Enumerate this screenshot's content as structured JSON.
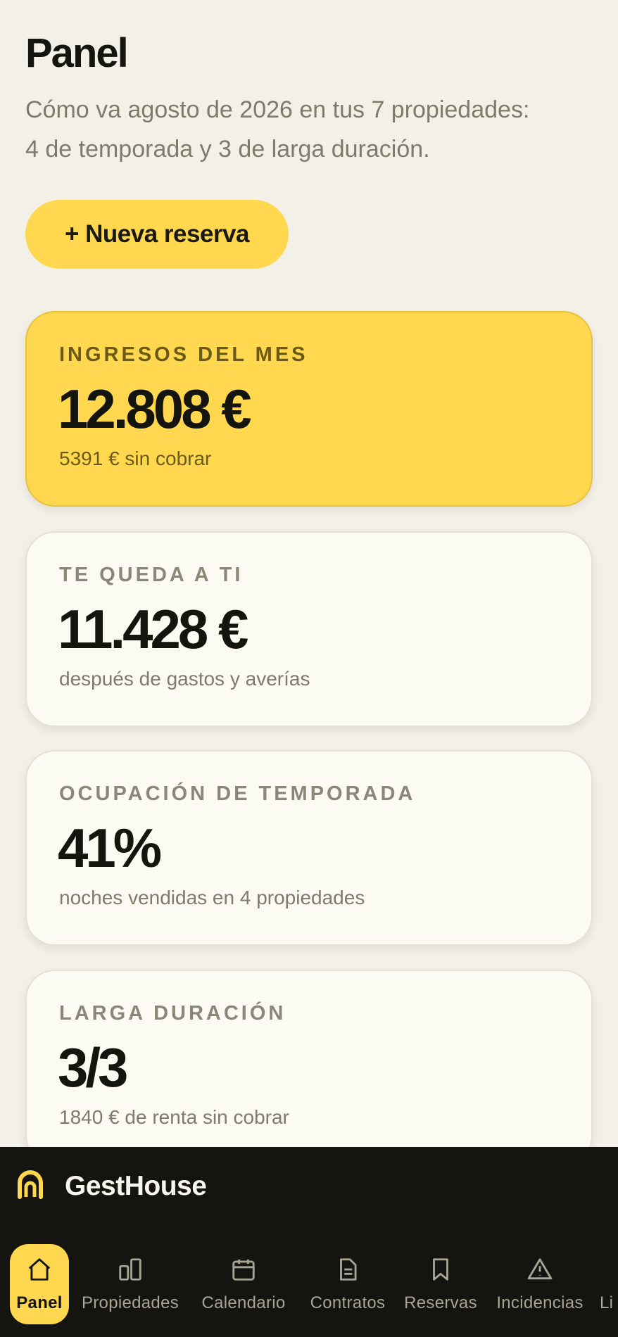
{
  "header": {
    "title": "Panel",
    "subtitle_line1": "Cómo va agosto de 2026 en tus 7 propiedades:",
    "subtitle_line2": "4 de temporada y 3 de larga duración."
  },
  "actions": {
    "new_booking": "+ Nueva reserva"
  },
  "cards": [
    {
      "label": "INGRESOS DEL MES",
      "value": "12.808 €",
      "note": "5391 € sin cobrar",
      "accent": true
    },
    {
      "label": "TE QUEDA A TI",
      "value": "11.428 €",
      "note": "después de gastos y averías",
      "accent": false
    },
    {
      "label": "OCUPACIÓN DE TEMPORADA",
      "value": "41%",
      "note": "noches vendidas en 4 propiedades",
      "accent": false
    },
    {
      "label": "LARGA DURACIÓN",
      "value": "3/3",
      "note": "1840 € de renta sin cobrar",
      "accent": false
    }
  ],
  "brand": {
    "name": "GestHouse",
    "icon": "gesthouse-logo-icon"
  },
  "nav": [
    {
      "label": "Panel",
      "icon": "home-icon",
      "active": true
    },
    {
      "label": "Propiedades",
      "icon": "buildings-icon",
      "active": false
    },
    {
      "label": "Calendario",
      "icon": "calendar-icon",
      "active": false
    },
    {
      "label": "Contratos",
      "icon": "document-icon",
      "active": false
    },
    {
      "label": "Reservas",
      "icon": "bookmark-icon",
      "active": false
    },
    {
      "label": "Incidencias",
      "icon": "warning-icon",
      "active": false
    },
    {
      "label": "Li",
      "icon": "cleaning-icon",
      "active": false
    }
  ],
  "colors": {
    "background": "#f3f0e7",
    "accent": "#ffd84f",
    "card": "#fbfaf3",
    "nav_background": "#141411",
    "muted_text": "#7e7a6c"
  }
}
